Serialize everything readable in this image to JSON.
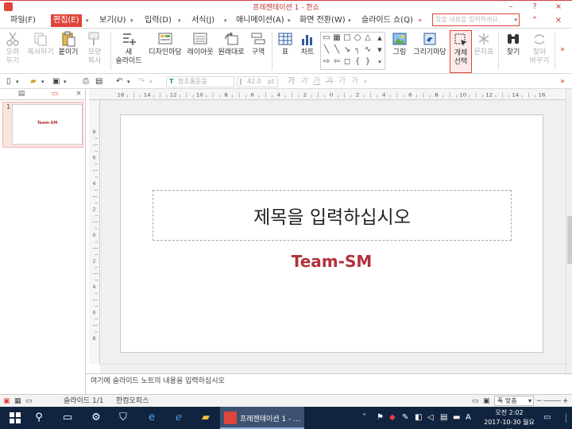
{
  "window": {
    "title": "프레젠테이션 1 - 한쇼",
    "minimize": "–",
    "help": "?",
    "close": "×"
  },
  "menu": {
    "items": [
      "파일(F)",
      "편집(E)",
      "보기(U)",
      "입력(D)",
      "서식(J)",
      "애니메이션(A)",
      "화면 전환(W)",
      "슬라이드 쇼(Q)"
    ],
    "more": "»",
    "search_placeholder": "찾을 내용을 입력하세요."
  },
  "ribbon": {
    "cut": "오려\n두기",
    "copy": "복사하기",
    "paste": "붙이기",
    "format_copy": "모양\n복사",
    "new_slide": "새\n슬라이드",
    "design": "디자인마당",
    "layout": "레이아웃",
    "reset": "원래대로",
    "section": "구역",
    "table": "표",
    "chart": "차트",
    "picture": "그림",
    "drawing": "그리기마당",
    "select_obj": "개체\n선택",
    "special_char": "문자표",
    "find": "찾기",
    "replace": "찾아\n바꾸기"
  },
  "toolbar2": {
    "font": "함초롬돋움",
    "size": "42.0",
    "unit": "pt",
    "style_chars": [
      "가",
      "가",
      "가",
      "가",
      "가",
      "가"
    ]
  },
  "panel": {
    "slide_number": "1",
    "thumb_text": "Team-SM",
    "close": "×"
  },
  "ruler": {
    "h_labels": [
      "16",
      "14",
      "12",
      "10",
      "8",
      "6",
      "4",
      "2",
      "0",
      "2",
      "4",
      "6",
      "8",
      "10",
      "12",
      "14",
      "16"
    ],
    "v_labels": [
      "8",
      "6",
      "4",
      "2",
      "0",
      "2",
      "4",
      "6",
      "8"
    ]
  },
  "slide": {
    "title": "제목을 입력하십시오",
    "subtitle": "Team-SM"
  },
  "notes": {
    "placeholder": "여기에 슬라이드 노트의 내용을 입력하십시오"
  },
  "status": {
    "slide_count": "슬라이드 1/1",
    "app_name": "한컴오피스",
    "zoom_mode": "폭 맞춤",
    "zoom_minus": "−",
    "zoom_plus": "+"
  },
  "taskbar": {
    "app_label": "프레젠테이션 1 - ...",
    "ime": "A",
    "time": "오전 2:02",
    "date": "2017-10-30 월요일"
  },
  "colors": {
    "accent": "#e0453a",
    "subtitle": "#b2323a",
    "taskbar": "#10243f"
  }
}
